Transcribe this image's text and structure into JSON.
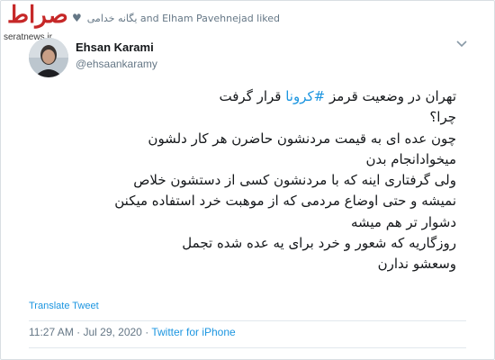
{
  "watermark": {
    "logo": "صراط",
    "site": "seratnews.ir"
  },
  "liked_by": {
    "text": "یگانه خدامی and Elham Pavehnejad liked",
    "icon": "heart-icon"
  },
  "author": {
    "name": "Ehsan Karami",
    "handle": "@ehsaankaramy"
  },
  "more_icon": "chevron-down-icon",
  "tweet": {
    "lines": [
      {
        "before": "تهران در وضعیت قرمز ",
        "hashtag": "#کرونا",
        "after": " قرار گرفت"
      },
      {
        "text": "چرا؟"
      },
      {
        "text": "چون عده ای به قیمت مردنشون حاضرن هر کار دلشون"
      },
      {
        "text": "میخوادانجام بدن"
      },
      {
        "text": "ولی گرفتاری اینه که با مردنشون کسی از دستشون خلاص"
      },
      {
        "text": "نمیشه و حتی اوضاع مردمی که از موهبت خرد استفاده میکنن"
      },
      {
        "text": "دشوار تر هم میشه"
      },
      {
        "text": "روزگاریه که شعور و خرد برای یه عده شده تجمل"
      },
      {
        "text": "وسعشو ندارن"
      }
    ]
  },
  "translate_label": "Translate Tweet",
  "meta": {
    "time": "11:27 AM · Jul 29, 2020 · ",
    "source": "Twitter for iPhone"
  },
  "colors": {
    "link": "#1b95e0",
    "muted": "#657786",
    "text": "#14171a"
  }
}
